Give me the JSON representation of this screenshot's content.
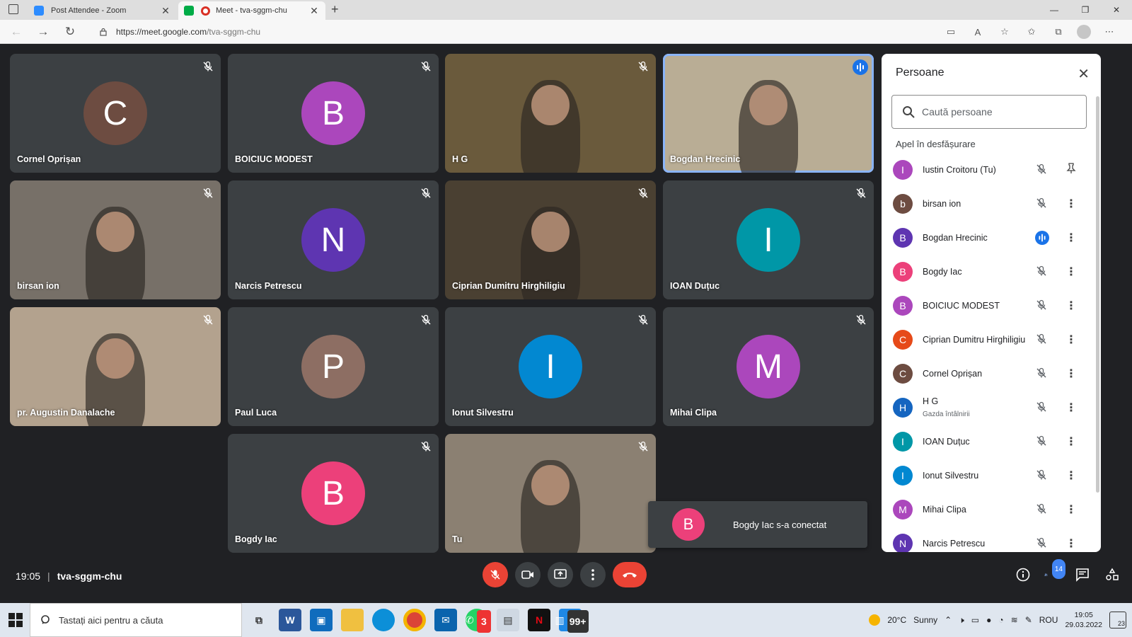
{
  "browser": {
    "tabs": [
      {
        "title": "Post Attendee - Zoom",
        "favicon_color": "#2d8cff"
      },
      {
        "title": "Meet - tva-sggm-chu",
        "favicon_color": "#00ac47"
      }
    ],
    "url_domain": "https://meet.google.com",
    "url_path": "/tva-sggm-chu"
  },
  "colors": {
    "speaking_outline": "#8ab4f8",
    "end_call": "#ea4335",
    "tile_bg": "#3c4043"
  },
  "tiles": [
    {
      "name": "Cornel Oprișan",
      "initial": "C",
      "color": "#6d4c41",
      "type": "avatar"
    },
    {
      "name": "BOICIUC MODEST",
      "initial": "B",
      "color": "#ab47bc",
      "type": "avatar"
    },
    {
      "name": "H G",
      "type": "video"
    },
    {
      "name": "Bogdan Hrecinic",
      "type": "video",
      "speaking": true
    },
    {
      "name": "birsan ion",
      "type": "video"
    },
    {
      "name": "Narcis Petrescu",
      "initial": "N",
      "color": "#5e35b1",
      "type": "avatar"
    },
    {
      "name": "Ciprian Dumitru Hirghiligiu",
      "type": "video"
    },
    {
      "name": "IOAN Duțuc",
      "initial": "I",
      "color": "#0097a7",
      "type": "avatar"
    },
    {
      "name": "pr. Augustin Danalache",
      "type": "video"
    },
    {
      "name": "Paul Luca",
      "initial": "P",
      "color": "#8d6e63",
      "type": "avatar"
    },
    {
      "name": "Ionut Silvestru",
      "initial": "I",
      "color": "#0288d1",
      "type": "avatar"
    },
    {
      "name": "Mihai Clipa",
      "initial": "M",
      "color": "#ab47bc",
      "type": "avatar"
    },
    {
      "name": "Bogdy Iac",
      "initial": "B",
      "color": "#ec407a",
      "type": "avatar"
    },
    {
      "name": "Tu",
      "type": "video"
    }
  ],
  "toast": {
    "initial": "B",
    "color": "#ec407a",
    "text": "Bogdy Iac s-a conectat"
  },
  "panel": {
    "title": "Persoane",
    "search_placeholder": "Caută persoane",
    "section": "Apel în desfășurare",
    "people": [
      {
        "initial": "I",
        "name": "Iustin Croitoru (Tu)",
        "color": "#ab47bc",
        "pin": true
      },
      {
        "initial": "b",
        "name": "birsan ion",
        "color": "#6d4c41"
      },
      {
        "initial": "B",
        "name": "Bogdan Hrecinic",
        "color": "#5e35b1",
        "speaking": true
      },
      {
        "initial": "B",
        "name": "Bogdy Iac",
        "color": "#ec407a"
      },
      {
        "initial": "B",
        "name": "BOICIUC MODEST",
        "color": "#ab47bc"
      },
      {
        "initial": "C",
        "name": "Ciprian Dumitru Hirghiligiu",
        "color": "#e64a19"
      },
      {
        "initial": "C",
        "name": "Cornel Oprișan",
        "color": "#6d4c41"
      },
      {
        "initial": "H",
        "name": "H G",
        "color": "#1565c0",
        "sub": "Gazda întâlnirii"
      },
      {
        "initial": "I",
        "name": "IOAN Duțuc",
        "color": "#0097a7"
      },
      {
        "initial": "I",
        "name": "Ionut Silvestru",
        "color": "#0288d1"
      },
      {
        "initial": "M",
        "name": "Mihai Clipa",
        "color": "#ab47bc"
      },
      {
        "initial": "N",
        "name": "Narcis Petrescu",
        "color": "#5e35b1"
      }
    ]
  },
  "meeting": {
    "time": "19:05",
    "code": "tva-sggm-chu",
    "people_count": "14"
  },
  "taskbar": {
    "search_placeholder": "Tastați aici pentru a căuta",
    "whatsapp_badge": "3",
    "files_badge": "99+",
    "temperature": "20°C",
    "weather": "Sunny",
    "lang": "ROU",
    "time": "19:05",
    "date": "29.03.2022",
    "notifications": "23"
  }
}
